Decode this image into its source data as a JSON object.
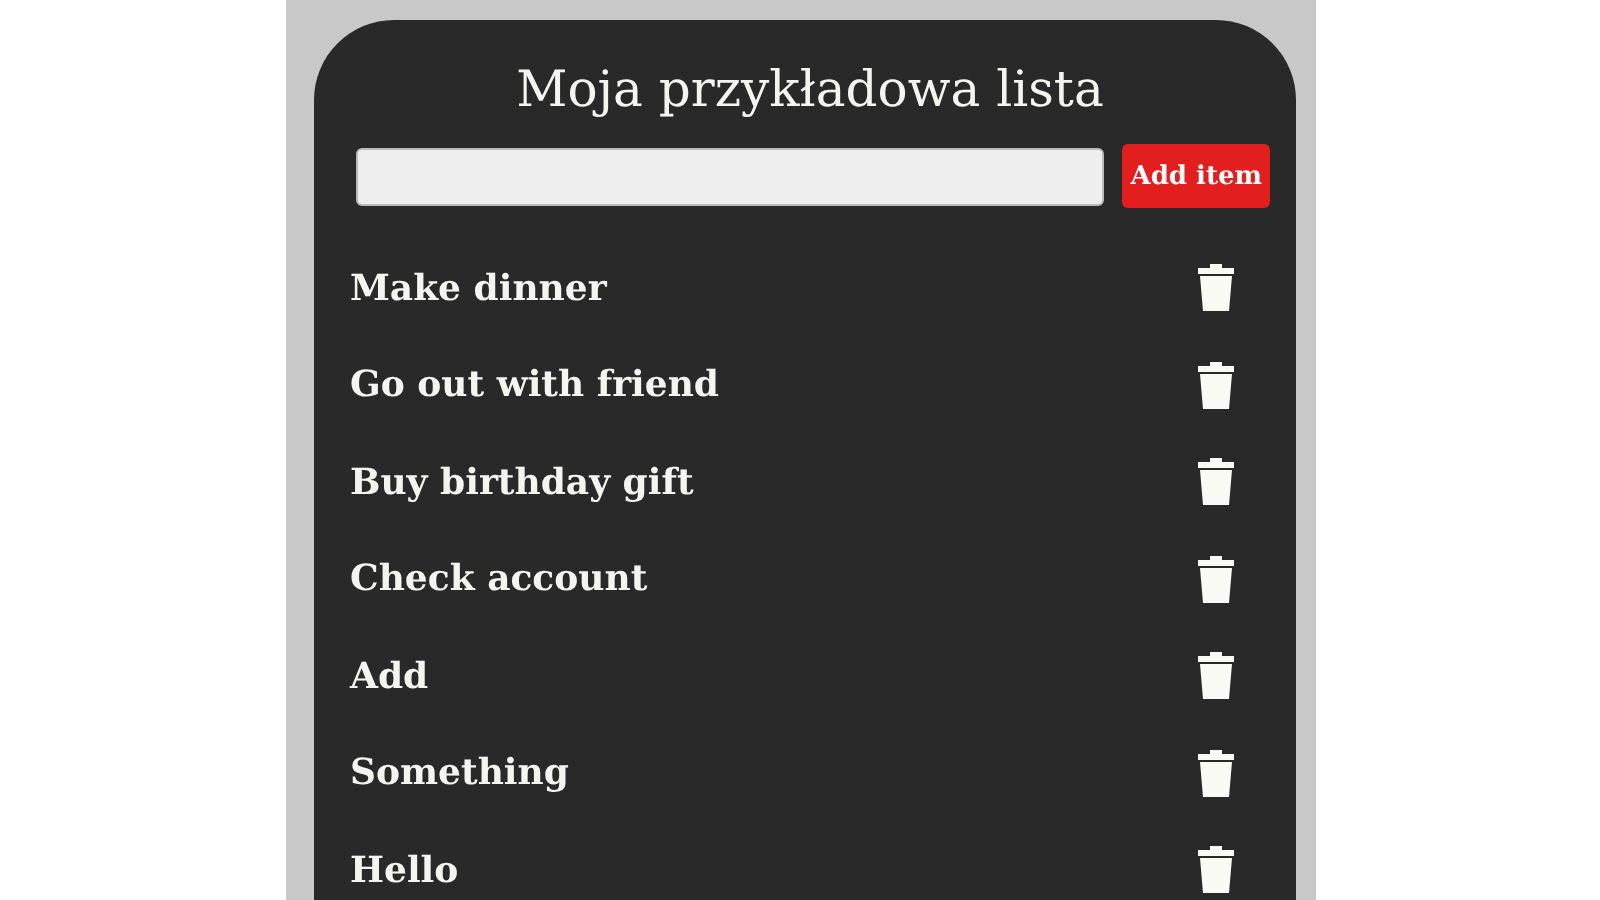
{
  "title": "Moja przykładowa lista",
  "add_button": {
    "label": "Add item"
  },
  "items": [
    {
      "text": "Make dinner"
    },
    {
      "text": "Go out with friend"
    },
    {
      "text": "Buy birthday gift"
    },
    {
      "text": "Check account"
    },
    {
      "text": "Add"
    },
    {
      "text": "Something"
    },
    {
      "text": "Hello"
    }
  ]
}
